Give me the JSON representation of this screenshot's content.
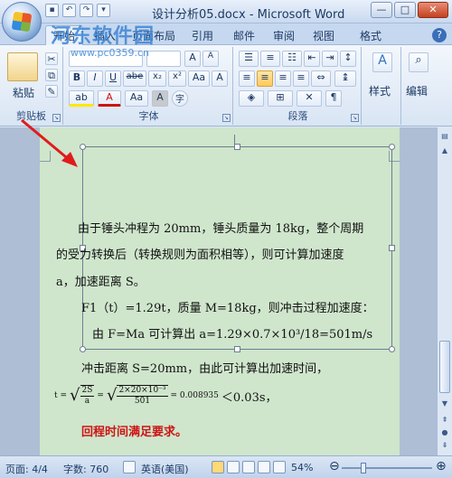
{
  "window": {
    "title": "设计分析05.docx - Microsoft Word",
    "minimize": "—",
    "maximize": "□",
    "close": "✕"
  },
  "watermark": {
    "text": "河东软件园",
    "url": "www.pc0359.cn"
  },
  "tabs": [
    {
      "label": "开始",
      "active": true
    },
    {
      "label": "插入"
    },
    {
      "label": "页面布局"
    },
    {
      "label": "引用"
    },
    {
      "label": "邮件"
    },
    {
      "label": "审阅"
    },
    {
      "label": "视图"
    },
    {
      "label": "格式"
    }
  ],
  "help": "?",
  "ribbon": {
    "clipboard": {
      "label": "剪贴板",
      "paste": "粘贴"
    },
    "font": {
      "label": "字体",
      "bold": "B",
      "italic": "I",
      "underline": "U",
      "strike": "abe",
      "subscript": "x₂",
      "superscript": "x²",
      "change_case": "Aa",
      "grow": "A",
      "shrink": "A",
      "clear": "A",
      "font_color": "A",
      "highlight": "ab",
      "char_shade": "A",
      "enclose": "字"
    },
    "paragraph": {
      "label": "段落"
    },
    "styles": {
      "label": "样式"
    },
    "editing": {
      "label": "编辑"
    }
  },
  "document": {
    "line1": "由于锤头冲程为 20mm，锤头质量为 18kg，整个周期",
    "line2": "的受力转换后（转换规则为面积相等），则可计算加速度",
    "line3": "a，加速距离 S。",
    "line4": "F1（t）=1.29t，质量 M=18kg，则冲击过程加速度：",
    "line5": "由 F=Ma   可计算出 a=1.29×0.7×10³/18=501m/s",
    "line6": "冲击距离   S=20mm，由此可计算出加速时间，",
    "formula": {
      "lhs": "t =",
      "frac1_num": "2S",
      "frac1_den": "a",
      "eq": "=",
      "frac2_num": "2×20×10⁻³",
      "frac2_den": "501",
      "result": "= 0.008935",
      "compare": "＜0.03s，"
    },
    "line7": "回程时间满足要求。"
  },
  "statusbar": {
    "page": "页面: 4/4",
    "words": "字数: 760",
    "language": "英语(美国)",
    "zoom": "54%",
    "zoom_value": 54
  }
}
